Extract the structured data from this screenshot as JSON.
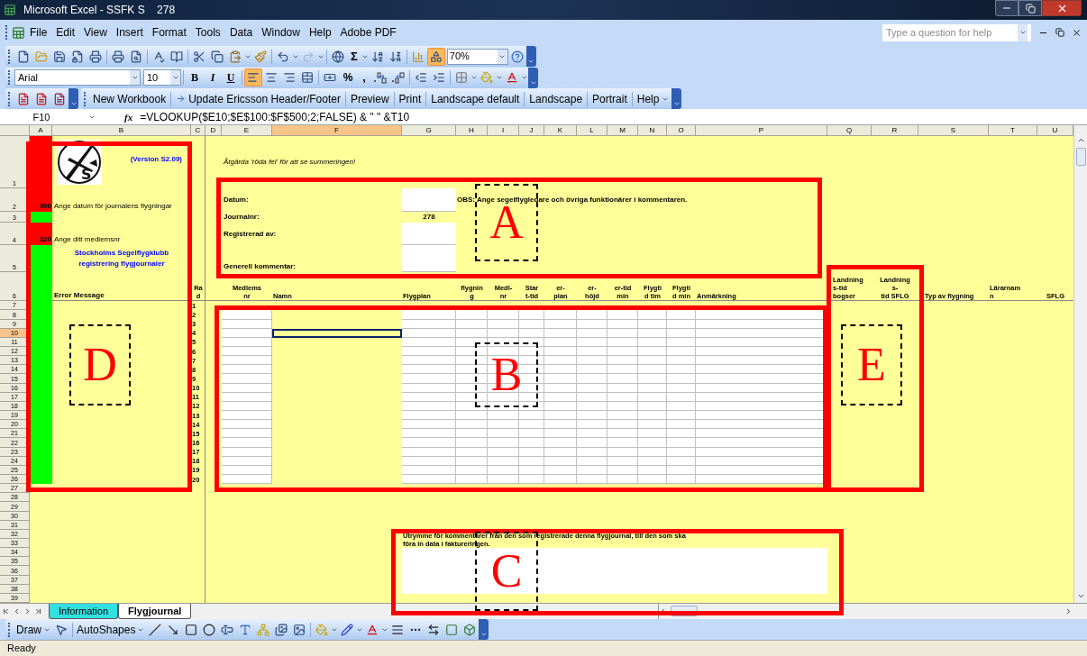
{
  "window": {
    "title": "Microsoft Excel - SSFK S    278"
  },
  "menu": [
    {
      "label": "File"
    },
    {
      "label": "Edit"
    },
    {
      "label": "View"
    },
    {
      "label": "Insert"
    },
    {
      "label": "Format"
    },
    {
      "label": "Tools"
    },
    {
      "label": "Data"
    },
    {
      "label": "Window"
    },
    {
      "label": "Help"
    },
    {
      "label": "Adobe PDF"
    }
  ],
  "help_search": {
    "placeholder": "Type a question for help"
  },
  "standard_toolbar": {
    "sum": "Σ",
    "zoom": "70%",
    "drawing": {
      "selected": true
    }
  },
  "formatting_toolbar": {
    "font": "Arial",
    "size": "10",
    "bold": "B",
    "italic": "I",
    "underline": "U",
    "percent": "%",
    "comma": ",",
    "alignment": [
      {
        "selected": true
      },
      {
        "selected": false
      },
      {
        "selected": false
      },
      {
        "selected": false
      }
    ]
  },
  "custom_toolbar": {
    "buttons": [
      {
        "label": "New Workbook",
        "has_icon": false,
        "menu": false
      },
      {
        "label": "Update Ericsson Header/Footer",
        "has_icon": true,
        "menu": false
      },
      {
        "label": "Preview",
        "has_icon": false,
        "menu": false
      },
      {
        "label": "Print",
        "has_icon": false,
        "menu": false
      },
      {
        "label": "Landscape default",
        "has_icon": false,
        "menu": false
      },
      {
        "label": "Landscape",
        "has_icon": false,
        "menu": false
      },
      {
        "label": "Portrait",
        "has_icon": false,
        "menu": false
      },
      {
        "label": "Help",
        "has_icon": false,
        "menu": true
      }
    ]
  },
  "formula_bar": {
    "name_box": "F10",
    "function_label": "fx",
    "formula": "=VLOOKUP($E10;$E$100:$F$500;2;FALSE) & \" \" &T10"
  },
  "sheet": {
    "columns": [
      {
        "label": "A",
        "selected": false
      },
      {
        "label": "B",
        "selected": false
      },
      {
        "label": "C",
        "selected": false
      },
      {
        "label": "D",
        "selected": false
      },
      {
        "label": "E",
        "selected": false
      },
      {
        "label": "F",
        "selected": true
      },
      {
        "label": "G",
        "selected": false
      },
      {
        "label": "H",
        "selected": false
      },
      {
        "label": "I",
        "selected": false
      },
      {
        "label": "J",
        "selected": false
      },
      {
        "label": "K",
        "selected": false
      },
      {
        "label": "L",
        "selected": false
      },
      {
        "label": "M",
        "selected": false
      },
      {
        "label": "N",
        "selected": false
      },
      {
        "label": "O",
        "selected": false
      },
      {
        "label": "P",
        "selected": false
      },
      {
        "label": "Q",
        "selected": false
      },
      {
        "label": "R",
        "selected": false
      },
      {
        "label": "S",
        "selected": false
      },
      {
        "label": "T",
        "selected": false
      },
      {
        "label": "U",
        "selected": false
      }
    ],
    "rows": [
      {
        "label": "1",
        "selected": false
      },
      {
        "label": "2",
        "selected": false
      },
      {
        "label": "3",
        "selected": false
      },
      {
        "label": "4",
        "selected": false
      },
      {
        "label": "5",
        "selected": false
      },
      {
        "label": "6",
        "selected": false
      },
      {
        "label": "7",
        "selected": false
      },
      {
        "label": "8",
        "selected": false
      },
      {
        "label": "9",
        "selected": false
      },
      {
        "label": "10",
        "selected": true
      },
      {
        "label": "11",
        "selected": false
      },
      {
        "label": "12",
        "selected": false
      },
      {
        "label": "13",
        "selected": false
      },
      {
        "label": "14",
        "selected": false
      },
      {
        "label": "15",
        "selected": false
      },
      {
        "label": "16",
        "selected": false
      },
      {
        "label": "17",
        "selected": false
      },
      {
        "label": "18",
        "selected": false
      },
      {
        "label": "19",
        "selected": false
      },
      {
        "label": "20",
        "selected": false
      },
      {
        "label": "21",
        "selected": false
      },
      {
        "label": "22",
        "selected": false
      },
      {
        "label": "23",
        "selected": false
      },
      {
        "label": "24",
        "selected": false
      },
      {
        "label": "25",
        "selected": false
      },
      {
        "label": "26",
        "selected": false
      },
      {
        "label": "27",
        "selected": false
      },
      {
        "label": "28",
        "selected": false
      },
      {
        "label": "29",
        "selected": false
      },
      {
        "label": "30",
        "selected": false
      },
      {
        "label": "31",
        "selected": false
      },
      {
        "label": "32",
        "selected": false
      },
      {
        "label": "33",
        "selected": false
      },
      {
        "label": "34",
        "selected": false
      },
      {
        "label": "35",
        "selected": false
      },
      {
        "label": "36",
        "selected": false
      },
      {
        "label": "37",
        "selected": false
      },
      {
        "label": "38",
        "selected": false
      },
      {
        "label": "39",
        "selected": false
      }
    ]
  },
  "sidebar": {
    "logo_letter": "S",
    "version": "(Version S2.09)",
    "club": "Stockholms Segelflygklubb\nregistrering flygjournaler",
    "error_header": "Error Message",
    "status_column": [
      {
        "color": "#ff0000"
      },
      {
        "color": "#ff0000",
        "code": "300",
        "message": "Ange datum för journalens flygningar"
      },
      {
        "color": "#00ff00"
      },
      {
        "color": "#ff0000",
        "code": "320",
        "message": "Ange ditt medlemsnr"
      },
      {
        "color": "#00ff00"
      },
      {
        "color": "#00ff00"
      },
      {
        "color": "#00ff00"
      },
      {
        "color": "#00ff00"
      },
      {
        "color": "#00ff00"
      },
      {
        "color": "#00ff00"
      },
      {
        "color": "#00ff00"
      },
      {
        "color": "#00ff00"
      },
      {
        "color": "#00ff00"
      },
      {
        "color": "#00ff00"
      },
      {
        "color": "#00ff00"
      },
      {
        "color": "#00ff00"
      },
      {
        "color": "#00ff00"
      },
      {
        "color": "#00ff00"
      },
      {
        "color": "#00ff00"
      },
      {
        "color": "#00ff00"
      },
      {
        "color": "#00ff00"
      },
      {
        "color": "#00ff00"
      },
      {
        "color": "#00ff00"
      },
      {
        "color": "#00ff00"
      },
      {
        "color": "#00ff00"
      },
      {
        "color": "#00ff00"
      }
    ]
  },
  "notice": "Åtgärda 'röda fel' för att se summeringen!",
  "form": {
    "fields": [
      {
        "label": "Datum:",
        "kind": "input"
      },
      {
        "label": "Journalnr:",
        "kind": "text",
        "value": "278"
      },
      {
        "label": "Registrerad av:",
        "kind": "input"
      },
      {
        "label": "Generell kommentar:",
        "kind": "input"
      }
    ],
    "obs": "OBS: Ange segelflygledare och övriga funktionärer i kommentaren."
  },
  "table": {
    "columns": [
      {
        "label": "Ra\nd"
      },
      {
        "label": "Medlems\nnr"
      },
      {
        "label": "Namn"
      },
      {
        "label": "Flygplan"
      },
      {
        "label": "flygnin\ng"
      },
      {
        "label": "Medl-\nnr"
      },
      {
        "label": "Star\nt-tid"
      },
      {
        "label": "er-\nplan"
      },
      {
        "label": "er-\nhöjd"
      },
      {
        "label": "er-tid\nmin"
      },
      {
        "label": "Flygti\nd tim"
      },
      {
        "label": "Flygti\nd min"
      },
      {
        "label": "Anmärkning"
      },
      {
        "label": "Landning\ns-tid\nbogser"
      },
      {
        "label": "Landning\ns-\ntid SFLG"
      },
      {
        "label": "Typ av flygning"
      },
      {
        "label": "Lärarnam\nn"
      },
      {
        "label": "SFLG"
      }
    ],
    "row_numbers": [
      "1",
      "2",
      "3",
      "4",
      "5",
      "6",
      "7",
      "8",
      "9",
      "10",
      "11",
      "12",
      "13",
      "14",
      "15",
      "16",
      "17",
      "18",
      "19",
      "20"
    ]
  },
  "comment_area": {
    "label": "Utrymme för kommentarer från den som registrerade denna flygjournal, till den som ska\nföra in data i faktureringen."
  },
  "sheet_tabs": [
    {
      "label": "Information",
      "selected": false
    },
    {
      "label": "Flygjournal",
      "selected": true
    }
  ],
  "draw_toolbar": {
    "draw": "Draw",
    "autoshapes": "AutoShapes"
  },
  "status_bar": {
    "text": "Ready"
  },
  "annotations": [
    {
      "letter": "A"
    },
    {
      "letter": "B"
    },
    {
      "letter": "C"
    },
    {
      "letter": "D"
    },
    {
      "letter": "E"
    }
  ]
}
